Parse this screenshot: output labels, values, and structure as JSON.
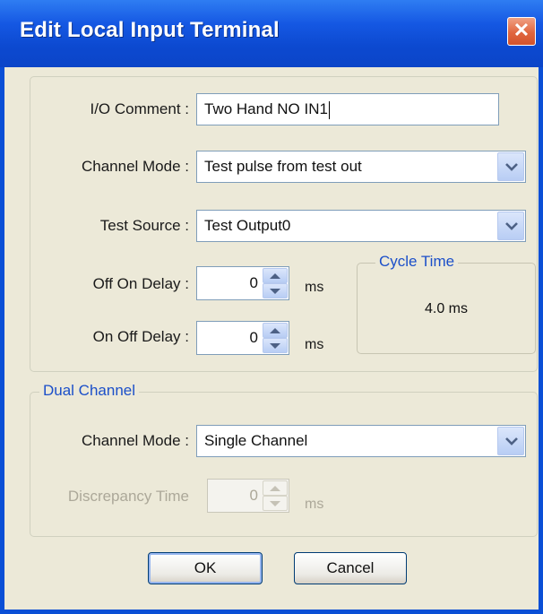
{
  "window": {
    "title": "Edit Local Input Terminal",
    "close_glyph": "✕"
  },
  "io_comment": {
    "label": "I/O Comment :",
    "value": "Two Hand NO IN1"
  },
  "channel_mode": {
    "label": "Channel Mode :",
    "value": "Test pulse from test out"
  },
  "test_source": {
    "label": "Test Source :",
    "value": "Test Output0"
  },
  "off_on_delay": {
    "label": "Off On Delay :",
    "value": "0",
    "unit": "ms"
  },
  "on_off_delay": {
    "label": "On Off Delay :",
    "value": "0",
    "unit": "ms"
  },
  "cycle_time": {
    "legend": "Cycle Time",
    "value": "4.0 ms"
  },
  "dual_channel": {
    "legend": "Dual Channel",
    "channel_mode_label": "Channel Mode :",
    "channel_mode_value": "Single Channel",
    "discrepancy_label": "Discrepancy Time",
    "discrepancy_value": "0",
    "discrepancy_unit": "ms"
  },
  "buttons": {
    "ok": "OK",
    "cancel": "Cancel"
  },
  "colors": {
    "titlebar": "#0b45c8",
    "group_legend": "#1b4fc9",
    "dialog_bg": "#ece9d8"
  }
}
